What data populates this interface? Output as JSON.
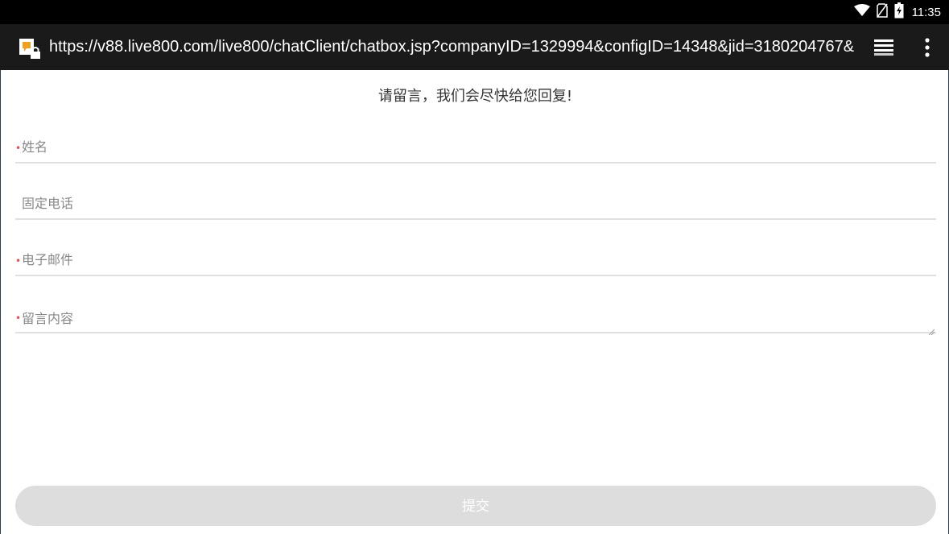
{
  "status_bar": {
    "time": "11:35",
    "icons": [
      "wifi-icon",
      "no-sim-icon",
      "battery-charging-icon"
    ]
  },
  "browser": {
    "url": "https://v88.live800.com/live800/chatClient/chatbox.jsp?companyID=1329994&configID=14348&jid=3180204767&",
    "icons": [
      "site-favicon-icon",
      "tabs-icon",
      "overflow-menu-icon"
    ]
  },
  "form": {
    "heading": "请留言，我们会尽快给您回复!",
    "required_mark": "•",
    "fields": {
      "name": {
        "placeholder": "姓名",
        "value": "",
        "required": true
      },
      "phone": {
        "placeholder": "固定电话",
        "value": "",
        "required": false
      },
      "email": {
        "placeholder": "电子邮件",
        "value": "",
        "required": true
      },
      "message": {
        "placeholder": "留言内容",
        "value": "",
        "required": true
      }
    },
    "submit_label": "提交"
  },
  "colors": {
    "status_bar_bg": "#000000",
    "browser_bar_bg": "#1a1a1a",
    "required_mark": "#e85050",
    "field_underline": "#e0e0e0",
    "button_bg": "#dddddd",
    "button_text": "#ffffff"
  }
}
